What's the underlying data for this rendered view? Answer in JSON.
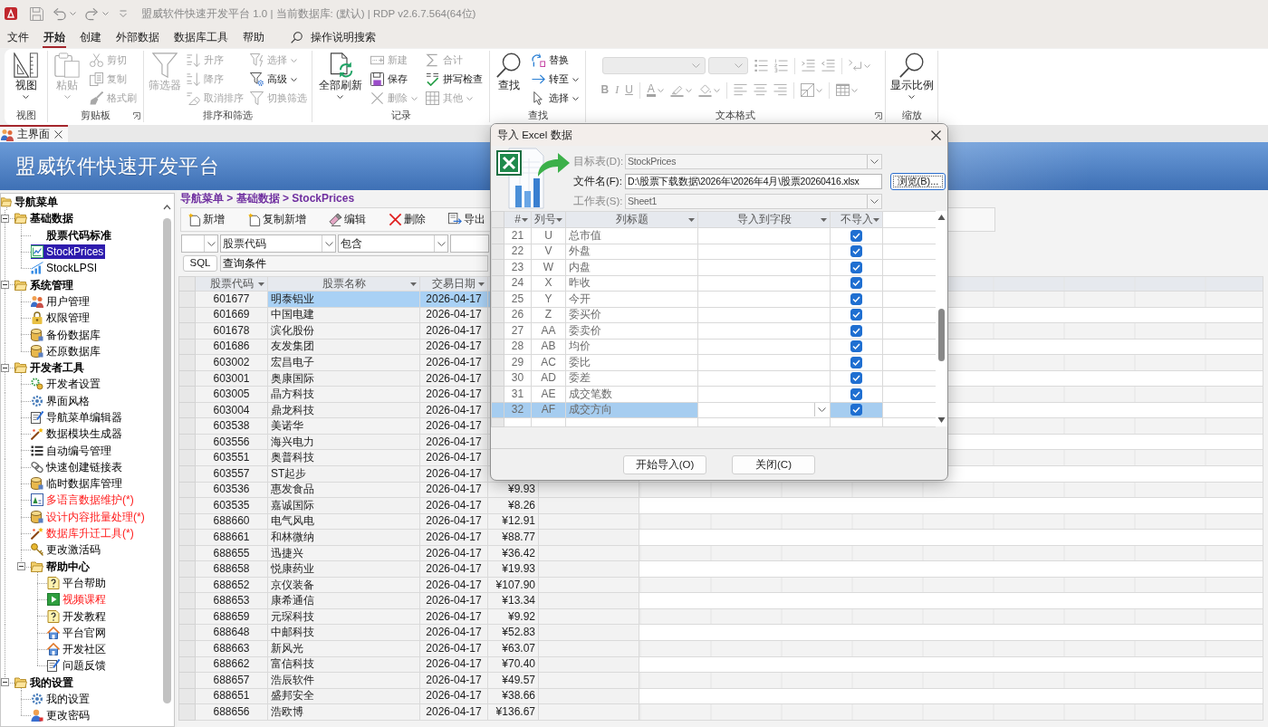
{
  "title_bar": {
    "title": "盟威软件快速开发平台 1.0 | 当前数据库: (默认) | RDP v2.6.7.564(64位)"
  },
  "menu_tabs": [
    {
      "label": "文件",
      "selected": false
    },
    {
      "label": "开始",
      "selected": true
    },
    {
      "label": "创建",
      "selected": false
    },
    {
      "label": "外部数据",
      "selected": false
    },
    {
      "label": "数据库工具",
      "selected": false
    },
    {
      "label": "帮助",
      "selected": false
    }
  ],
  "tell_me": {
    "placeholder": "操作说明搜索"
  },
  "ribbon": {
    "groups": [
      {
        "label": "视图",
        "launcher": false,
        "columns": [
          [
            {
              "kind": "large",
              "label": "视图",
              "disabled": false,
              "dropdown": true
            }
          ]
        ]
      },
      {
        "label": "剪贴板",
        "launcher": true,
        "columns": [
          [
            {
              "kind": "large",
              "label": "粘贴",
              "disabled": true,
              "dropdown": true
            }
          ],
          [
            {
              "kind": "small",
              "label": "剪切",
              "disabled": true,
              "dropdown": false
            },
            {
              "kind": "small",
              "label": "复制",
              "disabled": true,
              "dropdown": false
            },
            {
              "kind": "small",
              "label": "格式刷",
              "disabled": true,
              "dropdown": false
            }
          ]
        ]
      },
      {
        "label": "排序和筛选",
        "launcher": false,
        "columns": [
          [
            {
              "kind": "large",
              "label": "筛选器",
              "disabled": true,
              "dropdown": false
            }
          ],
          [
            {
              "kind": "small",
              "label": "升序",
              "disabled": true,
              "dropdown": false
            },
            {
              "kind": "small",
              "label": "降序",
              "disabled": true,
              "dropdown": false
            },
            {
              "kind": "small",
              "label": "取消排序",
              "disabled": true,
              "dropdown": false
            }
          ],
          [
            {
              "kind": "small",
              "label": "选择",
              "disabled": true,
              "dropdown": true
            },
            {
              "kind": "small",
              "label": "高级",
              "disabled": false,
              "dropdown": true
            },
            {
              "kind": "small",
              "label": "切换筛选",
              "disabled": true,
              "dropdown": false
            }
          ]
        ]
      },
      {
        "label": "记录",
        "launcher": false,
        "columns": [
          [
            {
              "kind": "large",
              "label": "全部刷新",
              "disabled": false,
              "dropdown": true
            }
          ],
          [
            {
              "kind": "small",
              "label": "新建",
              "disabled": true,
              "dropdown": false
            },
            {
              "kind": "small",
              "label": "保存",
              "disabled": false,
              "dropdown": false
            },
            {
              "kind": "small",
              "label": "删除",
              "disabled": true,
              "dropdown": true
            }
          ],
          [
            {
              "kind": "small",
              "label": "合计",
              "disabled": true,
              "dropdown": false
            },
            {
              "kind": "small",
              "label": "拼写检查",
              "disabled": false,
              "dropdown": false
            },
            {
              "kind": "small",
              "label": "其他",
              "disabled": true,
              "dropdown": true
            }
          ]
        ]
      },
      {
        "label": "查找",
        "launcher": false,
        "columns": [
          [
            {
              "kind": "large",
              "label": "查找",
              "disabled": false,
              "dropdown": false
            }
          ],
          [
            {
              "kind": "small",
              "label": "替换",
              "disabled": false,
              "dropdown": false
            },
            {
              "kind": "small",
              "label": "转至",
              "disabled": false,
              "dropdown": true
            },
            {
              "kind": "small",
              "label": "选择",
              "disabled": false,
              "dropdown": true
            }
          ]
        ]
      },
      {
        "label": "文本格式",
        "launcher": true,
        "rows": [
          [
            [
              {
                "kind": "combo",
                "disabled": true
              },
              {
                "kind": "combo",
                "disabled": true
              },
              {
                "kind": "icon",
                "disabled": true,
                "dropdown": false
              },
              {
                "kind": "icon",
                "disabled": true,
                "dropdown": false
              }
            ],
            [
              {
                "kind": "icon",
                "disabled": true,
                "dropdown": false
              },
              {
                "kind": "icon",
                "disabled": true,
                "dropdown": false
              }
            ],
            [
              {
                "kind": "icon",
                "disabled": true,
                "dropdown": true
              }
            ]
          ],
          [
            [
              {
                "kind": "letter",
                "label": "B",
                "disabled": true,
                "dropdown": false
              },
              {
                "kind": "letter",
                "label": "I",
                "disabled": true,
                "dropdown": false
              },
              {
                "kind": "letter",
                "label": "U",
                "disabled": true,
                "dropdown": false
              }
            ],
            [
              {
                "kind": "letter",
                "label": "A",
                "disabled": true,
                "dropdown": true
              },
              {
                "kind": "icon",
                "disabled": true,
                "dropdown": true
              },
              {
                "kind": "icon",
                "disabled": true,
                "dropdown": true
              }
            ],
            [
              {
                "kind": "icon",
                "disabled": true,
                "dropdown": false
              },
              {
                "kind": "icon",
                "disabled": true,
                "dropdown": false
              },
              {
                "kind": "icon",
                "disabled": true,
                "dropdown": false
              }
            ],
            [
              {
                "kind": "icon",
                "disabled": true,
                "dropdown": true
              }
            ],
            [
              {
                "kind": "icon",
                "disabled": true,
                "dropdown": true
              }
            ]
          ]
        ]
      },
      {
        "label": "缩放",
        "launcher": false,
        "columns": [
          [
            {
              "kind": "large",
              "label": "显示比例",
              "disabled": false,
              "dropdown": true
            }
          ]
        ]
      }
    ]
  },
  "document_tabs": [
    {
      "label": "主界面",
      "selected": true
    }
  ],
  "banner": {
    "title": "盟威软件快速开发平台"
  },
  "navigation_tree": {
    "label": "导航菜单",
    "children": [
      {
        "kind": "group",
        "label": "基础数据",
        "expanded": true,
        "selected": false,
        "children": [
          {
            "kind": "item",
            "label": "股票代码标准",
            "selected": false,
            "bold": true
          },
          {
            "kind": "item",
            "label": "StockPrices",
            "selected": true,
            "bold": false
          },
          {
            "kind": "item",
            "label": "StockLPSI",
            "selected": false,
            "bold": false
          }
        ]
      },
      {
        "kind": "group",
        "label": "系统管理",
        "expanded": true,
        "selected": false,
        "children": [
          {
            "kind": "item",
            "label": "用户管理",
            "selected": false
          },
          {
            "kind": "item",
            "label": "权限管理",
            "selected": false
          },
          {
            "kind": "item",
            "label": "备份数据库",
            "selected": false
          },
          {
            "kind": "item",
            "label": "还原数据库",
            "selected": false
          }
        ]
      },
      {
        "kind": "group",
        "label": "开发者工具",
        "expanded": true,
        "selected": false,
        "children": [
          {
            "kind": "item",
            "label": "开发者设置",
            "selected": false,
            "highlighted": false
          },
          {
            "kind": "item",
            "label": "界面风格",
            "selected": false,
            "highlighted": false
          },
          {
            "kind": "item",
            "label": "导航菜单编辑器",
            "selected": false,
            "highlighted": false
          },
          {
            "kind": "item",
            "label": "数据模块生成器",
            "selected": false,
            "highlighted": false
          },
          {
            "kind": "item",
            "label": "自动编号管理",
            "selected": false,
            "highlighted": false
          },
          {
            "kind": "item",
            "label": "快速创建链接表",
            "selected": false,
            "highlighted": false
          },
          {
            "kind": "item",
            "label": "临时数据库管理",
            "selected": false,
            "highlighted": false
          },
          {
            "kind": "item",
            "label": "多语言数据维护(*)",
            "selected": false,
            "highlighted": true
          },
          {
            "kind": "item",
            "label": "设计内容批量处理(*)",
            "selected": false,
            "highlighted": true
          },
          {
            "kind": "item",
            "label": "数据库升迁工具(*)",
            "selected": false,
            "highlighted": true
          },
          {
            "kind": "item",
            "label": "更改激活码",
            "selected": false,
            "highlighted": false
          },
          {
            "kind": "group",
            "label": "帮助中心",
            "expanded": true,
            "selected": false,
            "highlighted": false,
            "children": [
              {
                "kind": "item",
                "label": "平台帮助",
                "selected": false,
                "highlighted": false
              },
              {
                "kind": "item",
                "label": "视频课程",
                "selected": false,
                "highlighted": true
              },
              {
                "kind": "item",
                "label": "开发教程",
                "selected": false,
                "highlighted": false
              },
              {
                "kind": "item",
                "label": "平台官网",
                "selected": false,
                "highlighted": false
              },
              {
                "kind": "item",
                "label": "开发社区",
                "selected": false,
                "highlighted": false
              },
              {
                "kind": "item",
                "label": "问题反馈",
                "selected": false,
                "highlighted": false
              }
            ]
          }
        ]
      },
      {
        "kind": "group",
        "label": "我的设置",
        "expanded": true,
        "selected": false,
        "children": [
          {
            "kind": "item",
            "label": "我的设置",
            "selected": false
          },
          {
            "kind": "item",
            "label": "更改密码",
            "selected": false
          }
        ]
      }
    ]
  },
  "breadcrumb": "导航菜单 > 基础数据 > StockPrices",
  "toolbar": [
    "新增",
    "复制新增",
    "编辑",
    "删除",
    "导出"
  ],
  "filter": {
    "fields": [
      {
        "kind": "combo"
      },
      {
        "kind": "combo",
        "value": "股票代码"
      },
      {
        "kind": "combo",
        "value": "包含"
      },
      {
        "kind": "text"
      }
    ]
  },
  "query": {
    "button": "SQL",
    "value": "查询条件"
  },
  "grid": {
    "columns": [
      "股票代码",
      "股票名称",
      "交易日期"
    ],
    "rows": [
      {
        "selected": true,
        "cells": [
          "601677",
          "明泰铝业",
          "2026-04-17"
        ]
      },
      {
        "selected": false,
        "cells": [
          "601669",
          "中国电建",
          "2026-04-17"
        ]
      },
      {
        "selected": false,
        "cells": [
          "601678",
          "滨化股份",
          "2026-04-17"
        ]
      },
      {
        "selected": false,
        "cells": [
          "601686",
          "友发集团",
          "2026-04-17"
        ]
      },
      {
        "selected": false,
        "cells": [
          "603002",
          "宏昌电子",
          "2026-04-17"
        ]
      },
      {
        "selected": false,
        "cells": [
          "603001",
          "奥康国际",
          "2026-04-17"
        ]
      },
      {
        "selected": false,
        "cells": [
          "603005",
          "晶方科技",
          "2026-04-17"
        ]
      },
      {
        "selected": false,
        "cells": [
          "603004",
          "鼎龙科技",
          "2026-04-17"
        ]
      },
      {
        "selected": false,
        "cells": [
          "603538",
          "美诺华",
          "2026-04-17"
        ]
      },
      {
        "selected": false,
        "cells": [
          "603556",
          "海兴电力",
          "2026-04-17"
        ]
      },
      {
        "selected": false,
        "cells": [
          "603551",
          "奥普科技",
          "2026-04-17"
        ]
      },
      {
        "selected": false,
        "cells": [
          "603557",
          "ST起步",
          "2026-04-17"
        ]
      },
      {
        "selected": false,
        "cells": [
          "603536",
          "惠发食品",
          "2026-04-17",
          "¥9.93"
        ]
      },
      {
        "selected": false,
        "cells": [
          "603535",
          "嘉诚国际",
          "2026-04-17",
          "¥8.26"
        ]
      },
      {
        "selected": false,
        "cells": [
          "688660",
          "电气风电",
          "2026-04-17",
          "¥12.91"
        ]
      },
      {
        "selected": false,
        "cells": [
          "688661",
          "和林微纳",
          "2026-04-17",
          "¥88.77"
        ]
      },
      {
        "selected": false,
        "cells": [
          "688655",
          "迅捷兴",
          "2026-04-17",
          "¥36.42"
        ]
      },
      {
        "selected": false,
        "cells": [
          "688658",
          "悦康药业",
          "2026-04-17",
          "¥19.93"
        ]
      },
      {
        "selected": false,
        "cells": [
          "688652",
          "京仪装备",
          "2026-04-17",
          "¥107.90"
        ]
      },
      {
        "selected": false,
        "cells": [
          "688653",
          "康希通信",
          "2026-04-17",
          "¥13.34"
        ]
      },
      {
        "selected": false,
        "cells": [
          "688659",
          "元琛科技",
          "2026-04-17",
          "¥9.92"
        ]
      },
      {
        "selected": false,
        "cells": [
          "688648",
          "中邮科技",
          "2026-04-17",
          "¥52.83"
        ]
      },
      {
        "selected": false,
        "cells": [
          "688663",
          "新风光",
          "2026-04-17",
          "¥63.07"
        ]
      },
      {
        "selected": false,
        "cells": [
          "688662",
          "富信科技",
          "2026-04-17",
          "¥70.40"
        ]
      },
      {
        "selected": false,
        "cells": [
          "688657",
          "浩辰软件",
          "2026-04-17",
          "¥49.57"
        ]
      },
      {
        "selected": false,
        "cells": [
          "688651",
          "盛邦安全",
          "2026-04-17",
          "¥38.66"
        ]
      },
      {
        "selected": false,
        "cells": [
          "688656",
          "浩欧博",
          "2026-04-17",
          "¥136.67"
        ]
      }
    ]
  },
  "import_dialog": {
    "title": "导入 Excel 数据",
    "fields": [
      {
        "kind": "combo",
        "label": "目标表(D):",
        "value": "StockPrices",
        "disabled": true
      },
      {
        "kind": "text",
        "label": "文件名(F):",
        "value": "D:\\股票下载数据\\2026年\\2026年4月\\股票20260416.xlsx",
        "disabled": false
      },
      {
        "kind": "combo",
        "label": "工作表(S):",
        "value": "Sheet1",
        "disabled": true
      }
    ],
    "browse_button": "浏览(B)...",
    "columns": [
      "#",
      "列号",
      "列标题",
      "导入到字段",
      "不导入"
    ],
    "rows": [
      {
        "cells": [
          "21",
          "U",
          "总市值"
        ],
        "skip": true,
        "selected": false
      },
      {
        "cells": [
          "22",
          "V",
          "外盘"
        ],
        "skip": true,
        "selected": false
      },
      {
        "cells": [
          "23",
          "W",
          "内盘"
        ],
        "skip": true,
        "selected": false
      },
      {
        "cells": [
          "24",
          "X",
          "昨收"
        ],
        "skip": true,
        "selected": false
      },
      {
        "cells": [
          "25",
          "Y",
          "今开"
        ],
        "skip": true,
        "selected": false
      },
      {
        "cells": [
          "26",
          "Z",
          "委买价"
        ],
        "skip": true,
        "selected": false
      },
      {
        "cells": [
          "27",
          "AA",
          "委卖价"
        ],
        "skip": true,
        "selected": false
      },
      {
        "cells": [
          "28",
          "AB",
          "均价"
        ],
        "skip": true,
        "selected": false
      },
      {
        "cells": [
          "29",
          "AC",
          "委比"
        ],
        "skip": true,
        "selected": false
      },
      {
        "cells": [
          "30",
          "AD",
          "委差"
        ],
        "skip": true,
        "selected": false
      },
      {
        "cells": [
          "31",
          "AE",
          "成交笔数"
        ],
        "skip": true,
        "selected": false
      },
      {
        "cells": [
          "32",
          "AF",
          "成交方向"
        ],
        "skip": true,
        "selected": true
      }
    ],
    "buttons": [
      "开始导入(O)",
      "关闭(C)"
    ]
  }
}
